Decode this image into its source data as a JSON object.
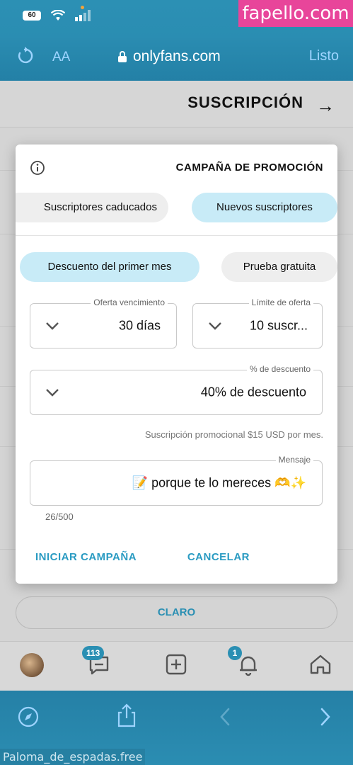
{
  "status": {
    "battery": "60"
  },
  "watermark_top": "fapello.com",
  "browser": {
    "aa_label": "AA",
    "url": "onlyfans.com",
    "done_label": "Listo"
  },
  "page": {
    "title": "SUSCRIPCIÓN",
    "claro_label": "CLARO"
  },
  "modal": {
    "title": "CAMPAÑA DE PROMOCIÓN",
    "audience_tabs": [
      {
        "label": "Nuevos suscriptores",
        "active": true
      },
      {
        "label": "Suscriptores caducados",
        "active": false
      }
    ],
    "type_tabs": [
      {
        "label": "Prueba gratuita",
        "active": false
      },
      {
        "label": "Descuento del primer mes",
        "active": true
      }
    ],
    "offer_limit": {
      "label": "Límite de oferta",
      "value": "10 suscr..."
    },
    "offer_expiry": {
      "label": "Oferta vencimiento",
      "value": "30 días"
    },
    "discount": {
      "label": "% de descuento",
      "value": "40% de descuento"
    },
    "hint": "Suscripción promocional $15 USD por mes.",
    "message": {
      "label": "Mensaje",
      "value": "📝 porque te lo mereces 🫶✨",
      "counter": "26/500"
    },
    "cancel_label": "CANCELAR",
    "start_label": "INICIAR CAMPAÑA"
  },
  "bottom_nav": {
    "notifications_badge": "1",
    "messages_badge": "113"
  },
  "watermark_bottom": "Paloma_de_espadas.free"
}
